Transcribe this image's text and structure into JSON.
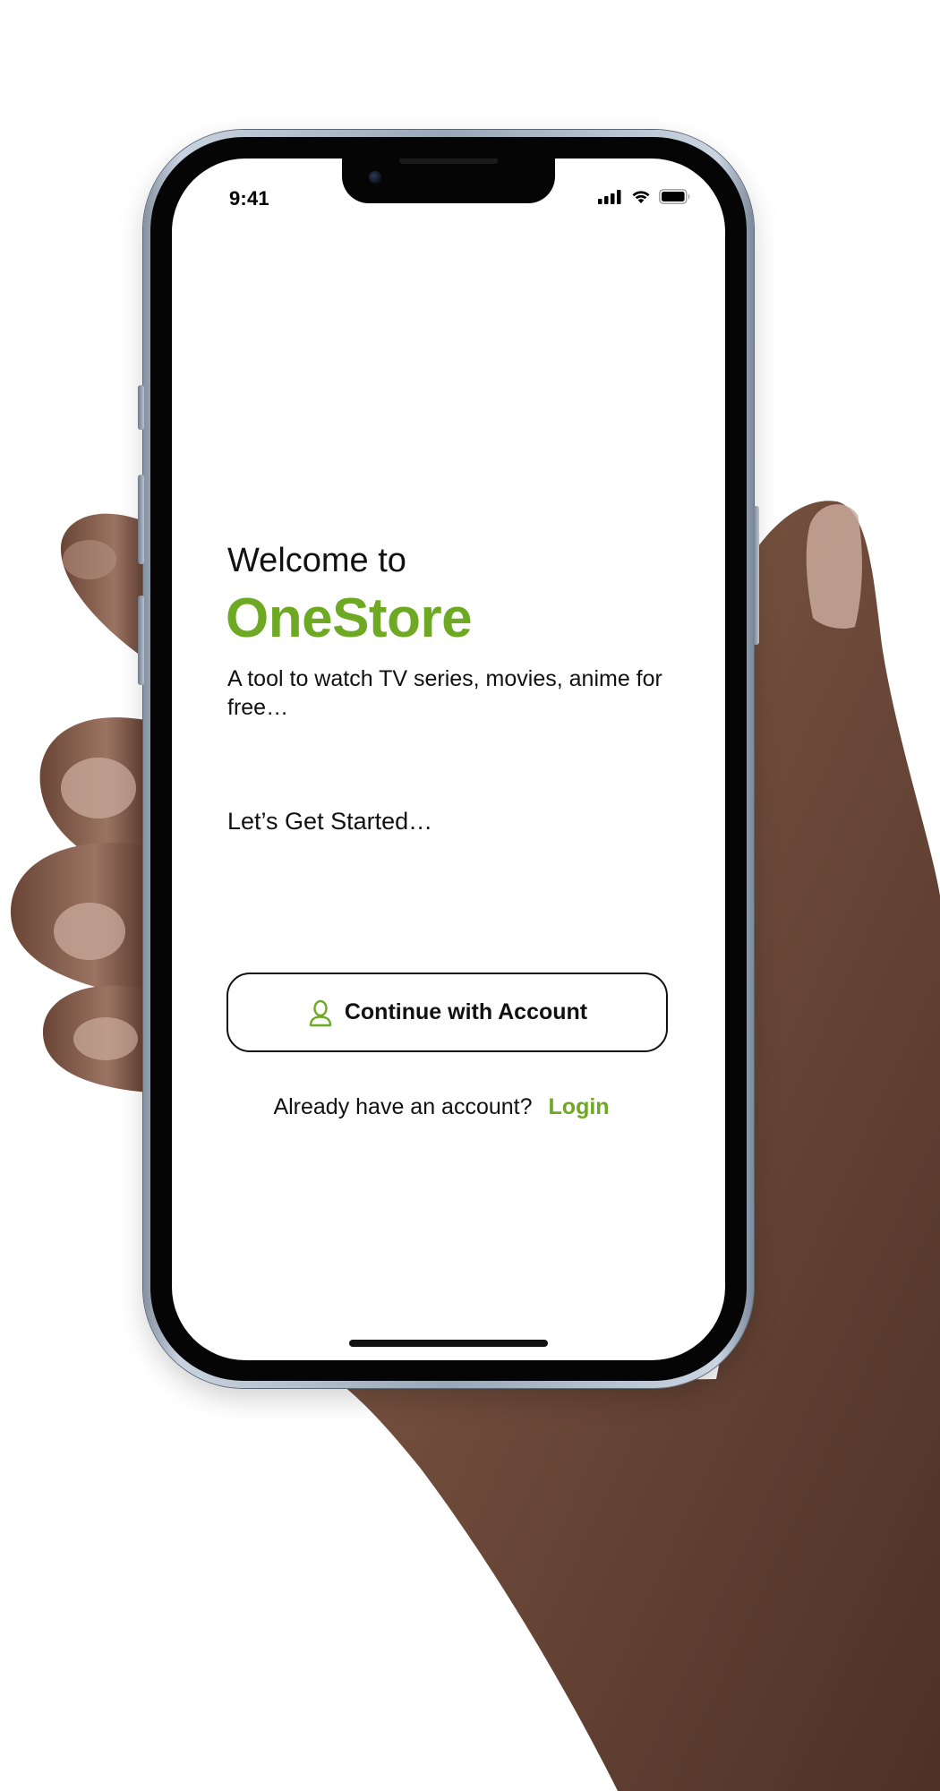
{
  "status_bar": {
    "time": "9:41",
    "icons": [
      "cellular-signal-icon",
      "wifi-icon",
      "battery-icon"
    ]
  },
  "welcome": {
    "intro": "Welcome to",
    "app_name": "OneStore",
    "tagline": "A tool to watch TV series, movies, anime for free…",
    "get_started": "Let’s Get Started…"
  },
  "actions": {
    "continue_label": "Continue with Account",
    "continue_icon": "user-icon",
    "login_prompt": "Already have an account?",
    "login_label": "Login"
  },
  "colors": {
    "brand_green": "#6ea923",
    "text_dark": "#111111",
    "background": "#ffffff"
  }
}
